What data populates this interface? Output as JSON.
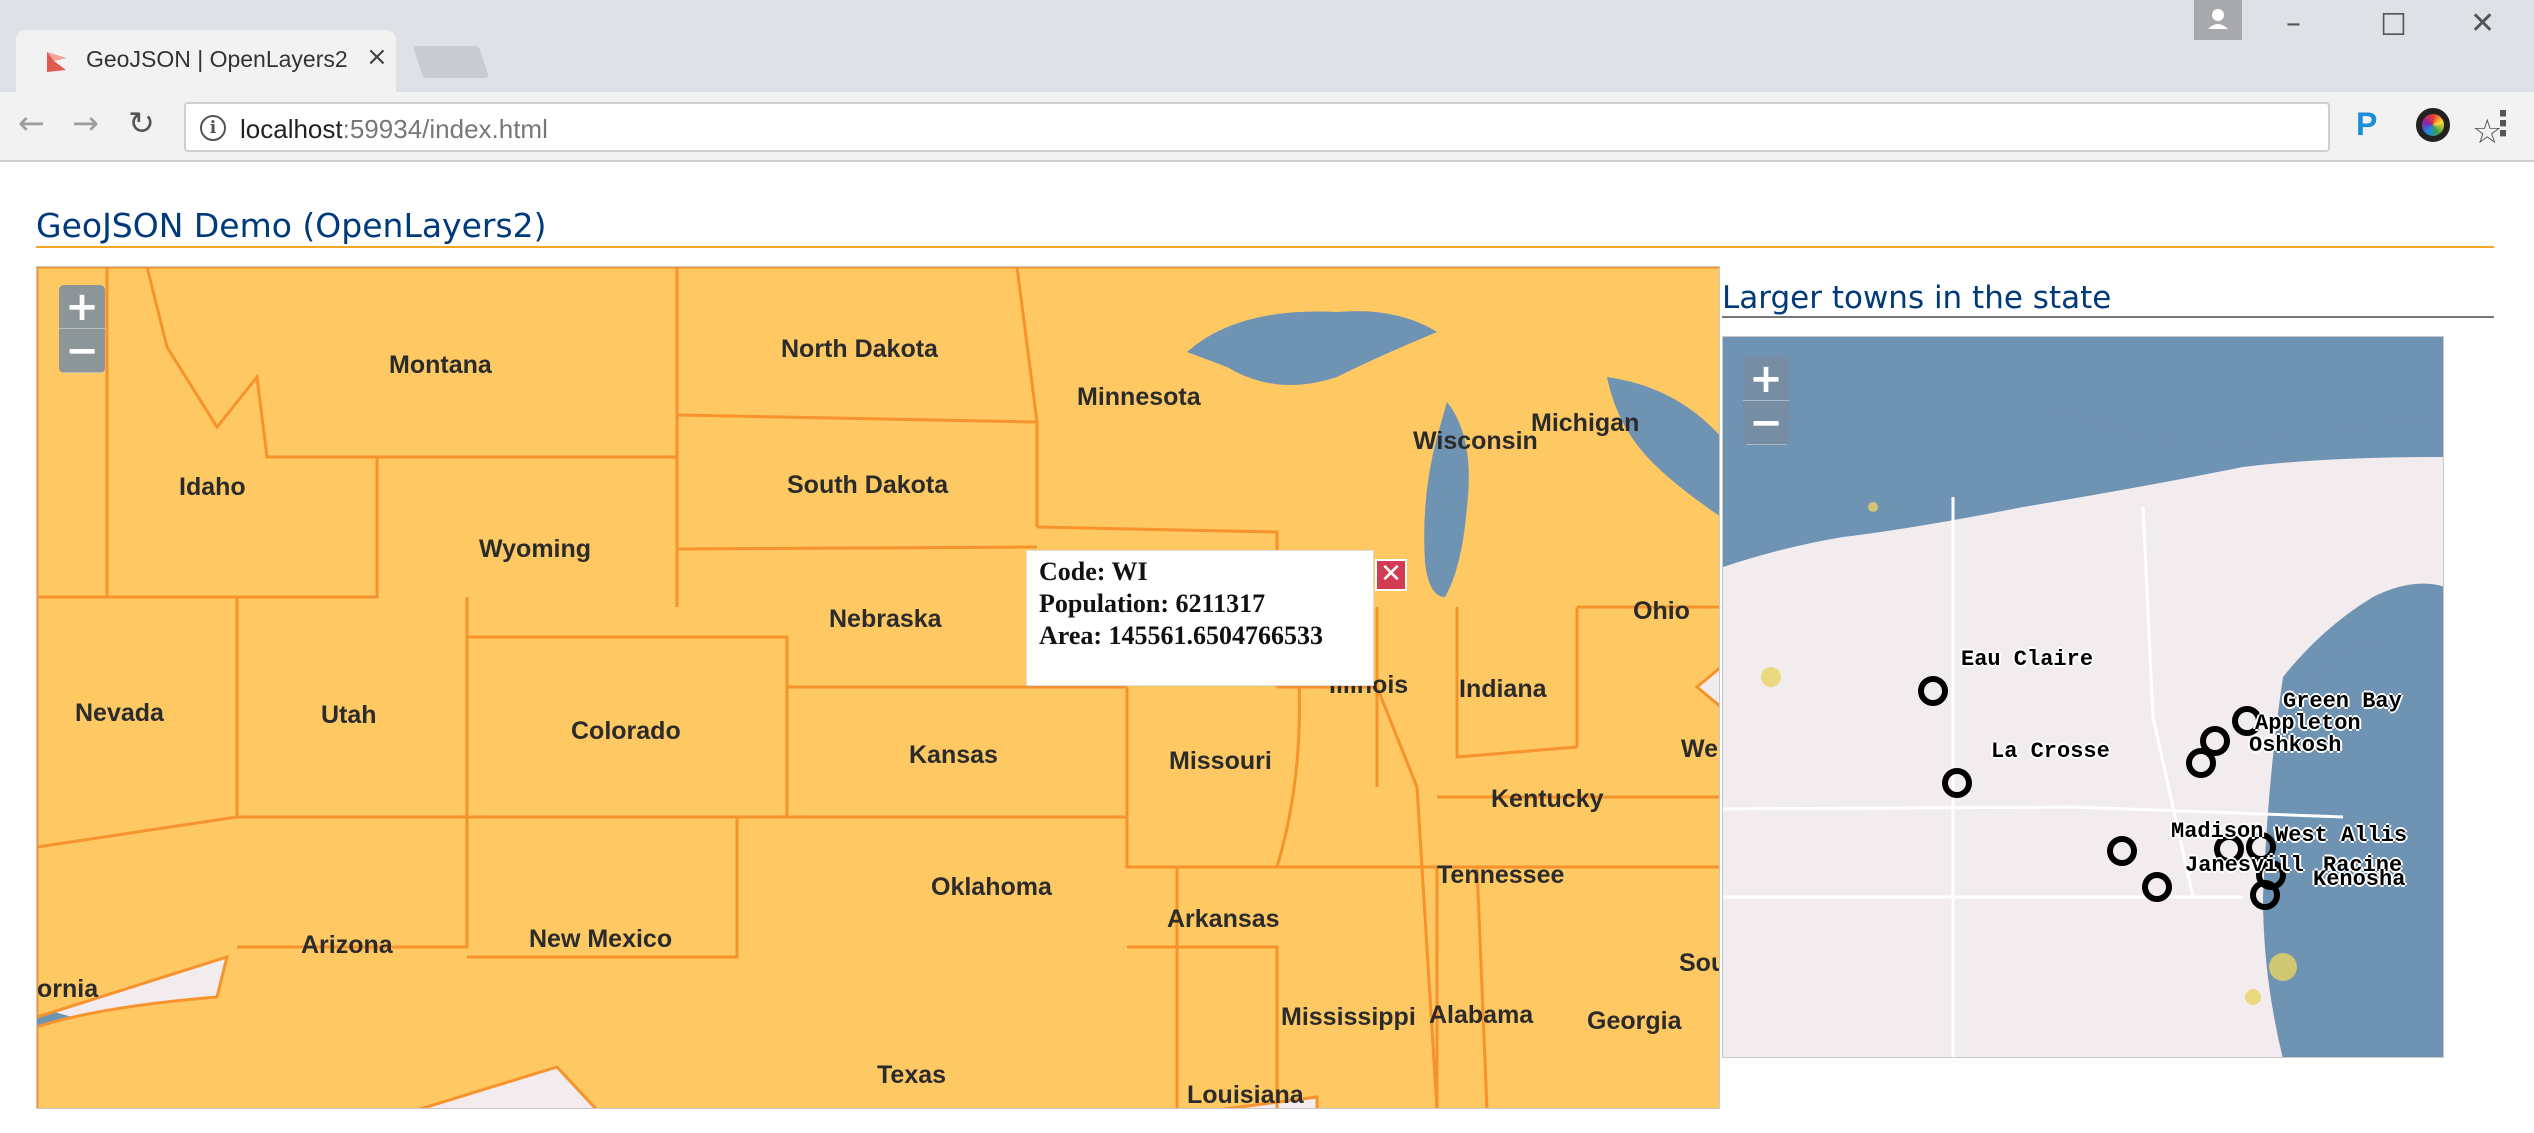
{
  "browser": {
    "tab_title": "GeoJSON | OpenLayers2",
    "url_host": "localhost",
    "url_rest": ":59934/index.html",
    "extension_letter": "P"
  },
  "page": {
    "title": "GeoJSON Demo (OpenLayers2)",
    "side_title": "Larger towns in the state"
  },
  "zoom": {
    "in": "+",
    "out": "−"
  },
  "popup": {
    "code": "Code: WI",
    "population": "Population: 6211317",
    "area": "Area: 145561.6504766533"
  },
  "states": [
    "Montana",
    "North Dakota",
    "Minnesota",
    "Wisconsin",
    "Michigan",
    "Idaho",
    "South Dakota",
    "Wyoming",
    "Nebraska",
    "Ohio",
    "Nevada",
    "Utah",
    "Colorado",
    "Illinois",
    "Indiana",
    "Kansas",
    "Missouri",
    "We",
    "Kentucky",
    "Oklahoma",
    "Tennessee",
    "Arkansas",
    "Arizona",
    "New Mexico",
    "Sout",
    "ornia",
    "Mississippi",
    "Alabama",
    "Georgia",
    "Texas",
    "Louisiana"
  ],
  "towns": [
    "Eau Claire",
    "Green Bay",
    "Appleton",
    "Oshkosh",
    "La Crosse",
    "Madison",
    "West Allis",
    "Janesvill",
    "Racine",
    "Kenosha"
  ],
  "colors": {
    "state_fill": "#fec863",
    "state_stroke": "#f7932d",
    "water": "#6f93b3",
    "land": "#f3ecee",
    "title": "#003a7a",
    "rule": "#f5a623"
  }
}
